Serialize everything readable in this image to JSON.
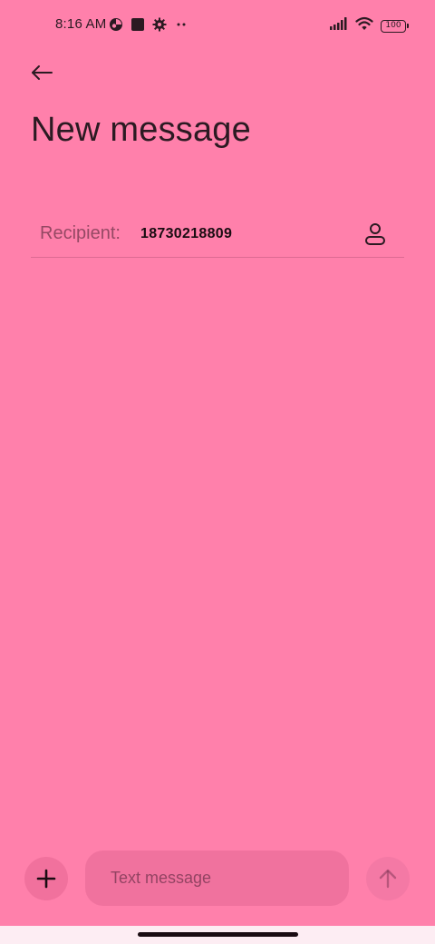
{
  "status_bar": {
    "time": "8:16 AM",
    "battery_level": "100",
    "left_icons": [
      "vpn-icon",
      "square-notification-icon",
      "settings-icon",
      "more-dots-icon"
    ],
    "right_icons": [
      "signal-icon",
      "wifi-icon",
      "battery-icon"
    ]
  },
  "header": {
    "title": "New message"
  },
  "recipient": {
    "label": "Recipient:",
    "value": "18730218809"
  },
  "composer": {
    "placeholder": "Text message"
  },
  "colors": {
    "background": "#FF80AB",
    "text": "#2b1a22",
    "nav_bar": "#FDEDF3"
  }
}
